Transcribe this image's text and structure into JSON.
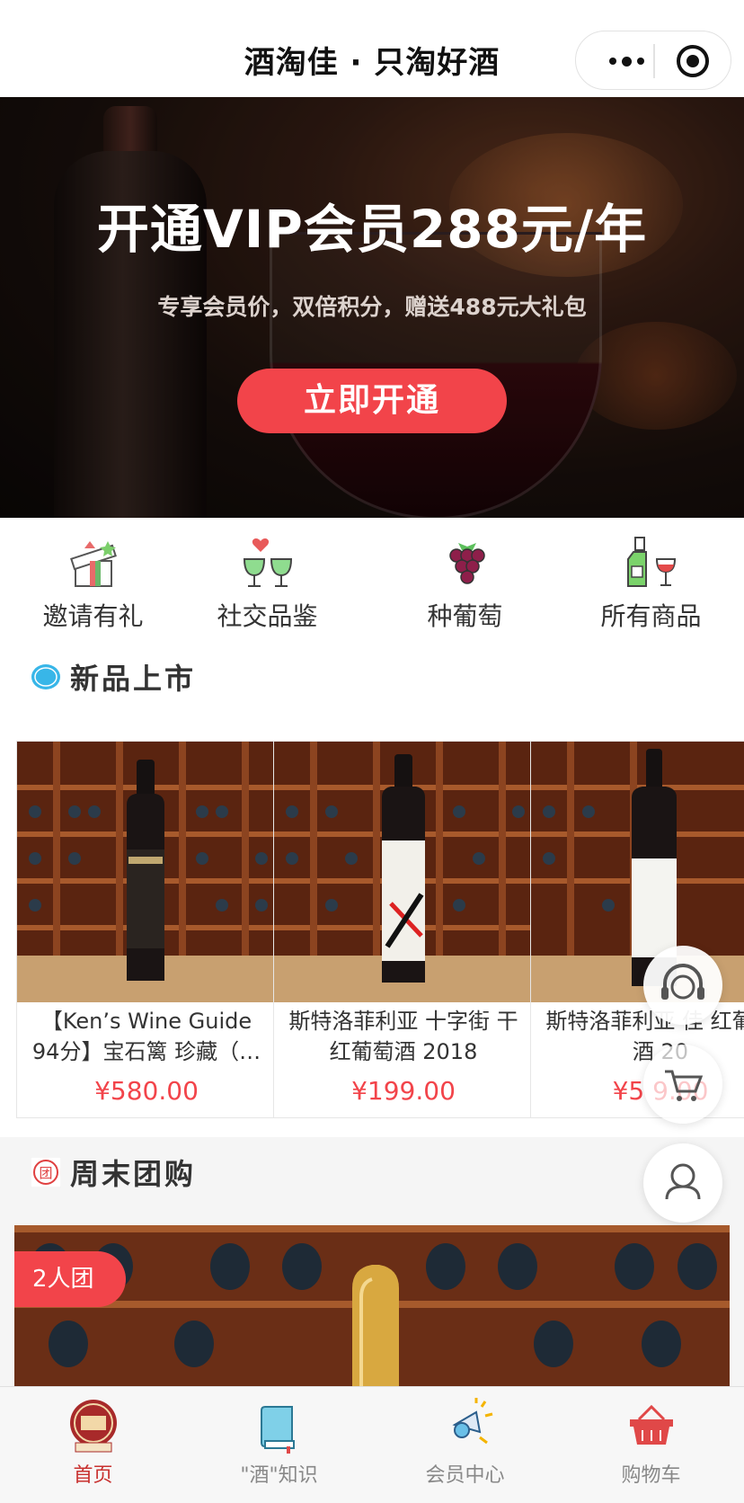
{
  "navbar": {
    "title": "酒淘佳 · 只淘好酒"
  },
  "banner": {
    "title": "开通VIP会员288元/年",
    "subtitle": "专享会员价，双倍积分，赠送488元大礼包",
    "button_label": "立即开通"
  },
  "quick_nav": [
    {
      "label": "邀请有礼",
      "icon": "gift-icon"
    },
    {
      "label": "社交品鉴",
      "icon": "wine-glasses-icon"
    },
    {
      "label": "种葡萄",
      "icon": "grapes-icon"
    },
    {
      "label": "所有商品",
      "icon": "wine-bottle-icon"
    }
  ],
  "new_products": {
    "title": "新品上市",
    "items": [
      {
        "name": "【Ken’s Wine Guide 94分】宝石篱 珍藏（…",
        "price": "¥580.00"
      },
      {
        "name": "斯特洛菲利亚 十字街 干红葡萄酒 2018",
        "price": "¥199.00"
      },
      {
        "name": "斯特洛菲利亚 佳 红葡萄酒 20",
        "price": "¥5 9.00"
      }
    ]
  },
  "group_buy": {
    "title": "周末团购",
    "badge": "2人团",
    "section_icon_label": "团"
  },
  "tabbar": {
    "tabs": [
      {
        "label": "首页",
        "active": true,
        "icon": "home-logo-icon"
      },
      {
        "label": "\"酒\"知识",
        "active": false,
        "icon": "book-icon"
      },
      {
        "label": "会员中心",
        "active": false,
        "icon": "member-icon"
      },
      {
        "label": "购物车",
        "active": false,
        "icon": "shopping-basket-icon"
      }
    ]
  },
  "colors": {
    "accent": "#f2444a",
    "tab_active": "#c8312f",
    "tab_inactive": "#888888"
  }
}
